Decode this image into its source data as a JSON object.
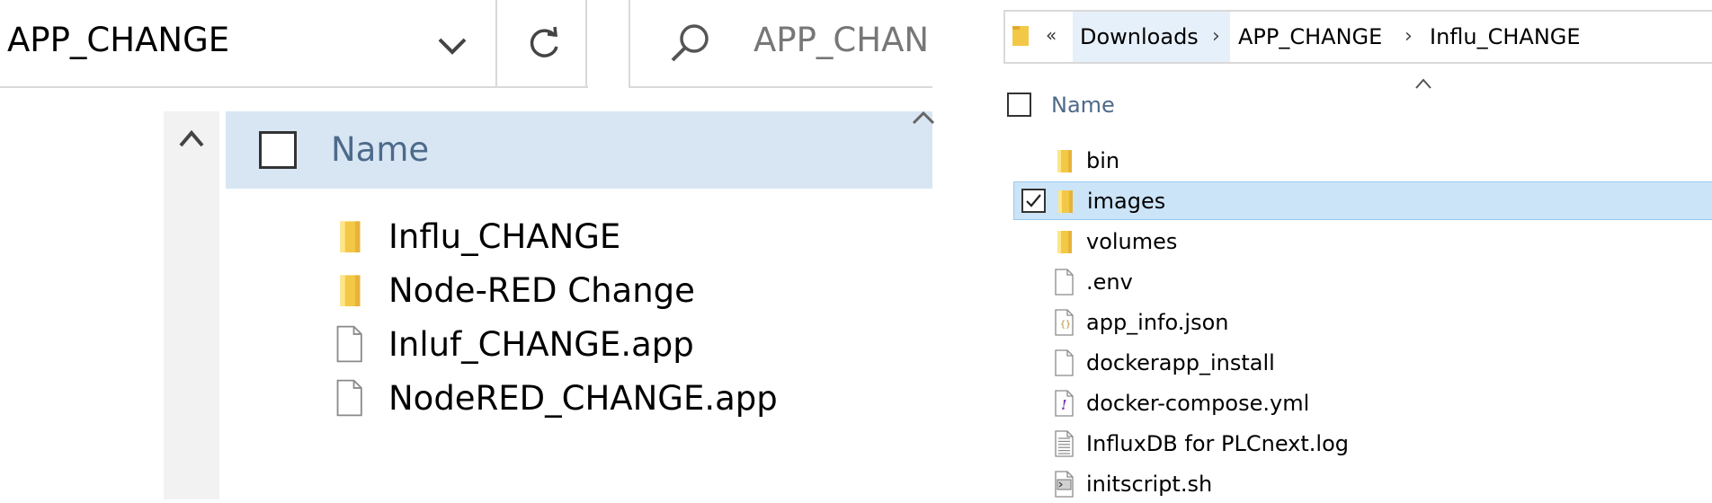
{
  "left_panel": {
    "address": {
      "current_folder": "APP_CHANGE"
    },
    "search": {
      "placeholder": "APP_CHAN"
    },
    "column_header": {
      "name_label": "Name"
    },
    "files": [
      {
        "name": "Influ_CHANGE",
        "type": "folder"
      },
      {
        "name": "Node-RED Change",
        "type": "folder"
      },
      {
        "name": "Inluf_CHANGE.app",
        "type": "file"
      },
      {
        "name": "NodeRED_CHANGE.app",
        "type": "file"
      }
    ]
  },
  "right_panel": {
    "breadcrumb": {
      "overflow": "«",
      "items": [
        "Downloads",
        "APP_CHANGE",
        "Influ_CHANGE"
      ],
      "separator": "›"
    },
    "column_header": {
      "name_label": "Name"
    },
    "files": [
      {
        "name": "bin",
        "type": "folder",
        "selected": false
      },
      {
        "name": "images",
        "type": "folder",
        "selected": true
      },
      {
        "name": "volumes",
        "type": "folder",
        "selected": false
      },
      {
        "name": ".env",
        "type": "file",
        "selected": false
      },
      {
        "name": "app_info.json",
        "type": "json",
        "selected": false
      },
      {
        "name": "dockerapp_install",
        "type": "file",
        "selected": false
      },
      {
        "name": "docker-compose.yml",
        "type": "yml",
        "selected": false
      },
      {
        "name": "InfluxDB for PLCnext.log",
        "type": "log",
        "selected": false
      },
      {
        "name": "initscript.sh",
        "type": "script",
        "selected": false
      }
    ]
  },
  "colors": {
    "header_bg": "#d8e6f4",
    "selected_row_bg": "#cce4f7",
    "selected_row_border": "#99c9ef",
    "folder_yellow": "#f3c846",
    "folder_light": "#fde68a",
    "column_label": "#4d6a8a"
  }
}
